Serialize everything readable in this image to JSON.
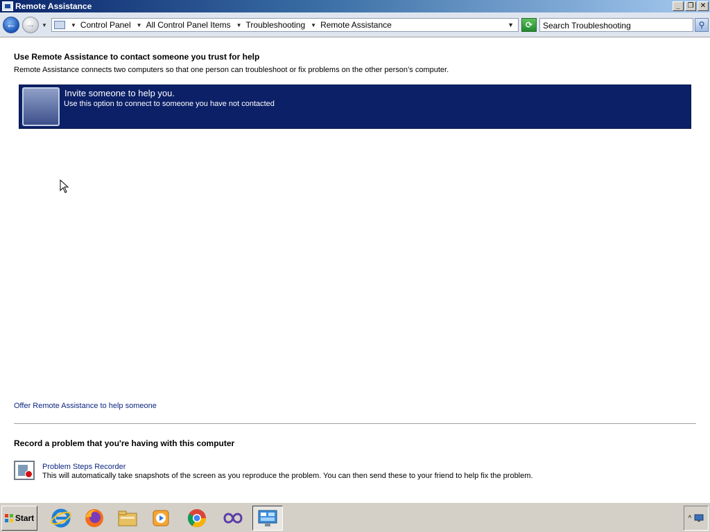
{
  "window": {
    "title": "Remote Assistance",
    "buttons": {
      "minimize": "_",
      "restore": "❐",
      "close": "✕"
    }
  },
  "addressbar": {
    "breadcrumbs": [
      "Control Panel",
      "All Control Panel Items",
      "Troubleshooting",
      "Remote Assistance"
    ],
    "search_placeholder": "Search Troubleshooting"
  },
  "main": {
    "heading": "Use Remote Assistance to contact someone you trust for help",
    "description": "Remote Assistance connects two computers so that one person can troubleshoot or fix problems on the other person’s computer.",
    "invite": {
      "title": "Invite someone to help you.",
      "subtitle": "Use this option to connect to someone you have not contacted"
    },
    "offer_link": "Offer Remote Assistance to help someone",
    "record_heading": "Record a problem that you're having with this computer",
    "psr": {
      "link": "Problem Steps Recorder",
      "description": "This will automatically take snapshots of the screen as you reproduce the problem. You can then send these to your friend to help fix the problem."
    }
  },
  "taskbar": {
    "start_label": "Start",
    "apps": [
      {
        "icon": "internet-explorer-icon"
      },
      {
        "icon": "firefox-icon"
      },
      {
        "icon": "file-explorer-icon"
      },
      {
        "icon": "media-player-icon"
      },
      {
        "icon": "chrome-icon"
      },
      {
        "icon": "visual-studio-icon"
      },
      {
        "icon": "control-panel-icon"
      }
    ]
  },
  "colors": {
    "accent": "#0b2067",
    "link": "#0b2580",
    "titlebar_start": "#0a246a",
    "titlebar_end": "#a6caf0"
  }
}
